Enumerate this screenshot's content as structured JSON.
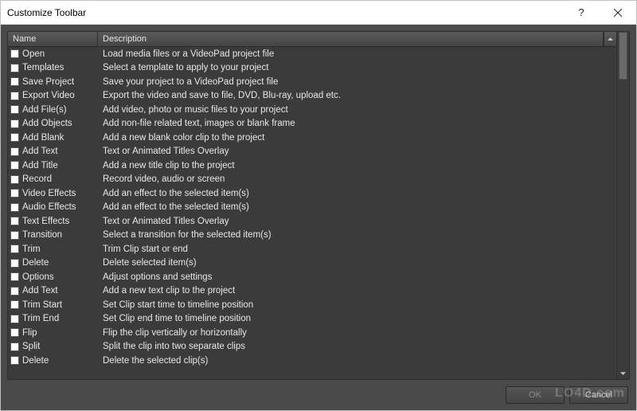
{
  "window": {
    "title": "Customize Toolbar"
  },
  "columns": {
    "name": "Name",
    "description": "Description"
  },
  "items": [
    {
      "name": "Open",
      "description": "Load media files or a VideoPad project file"
    },
    {
      "name": "Templates",
      "description": "Select a template to apply to your project"
    },
    {
      "name": "Save Project",
      "description": "Save your project to a VideoPad project file"
    },
    {
      "name": "Export Video",
      "description": "Export the video and save to file, DVD, Blu-ray, upload etc."
    },
    {
      "name": "Add File(s)",
      "description": "Add video, photo or music files to your project"
    },
    {
      "name": "Add Objects",
      "description": "Add non-file related text, images or blank frame"
    },
    {
      "name": "Add Blank",
      "description": "Add a new blank color clip to the project"
    },
    {
      "name": "Add Text",
      "description": "Text or Animated Titles Overlay"
    },
    {
      "name": "Add Title",
      "description": "Add a new title clip to the project"
    },
    {
      "name": "Record",
      "description": "Record video, audio or screen"
    },
    {
      "name": "Video Effects",
      "description": "Add an effect to the selected item(s)"
    },
    {
      "name": "Audio Effects",
      "description": "Add an effect to the selected item(s)"
    },
    {
      "name": "Text Effects",
      "description": "Text or Animated Titles Overlay"
    },
    {
      "name": "Transition",
      "description": "Select a transition for the selected item(s)"
    },
    {
      "name": "Trim",
      "description": "Trim Clip start or end"
    },
    {
      "name": "Delete",
      "description": "Delete selected item(s)"
    },
    {
      "name": "Options",
      "description": "Adjust options and settings"
    },
    {
      "name": "Add Text",
      "description": "Add a new text clip to the project"
    },
    {
      "name": "Trim Start",
      "description": "Set Clip start time to timeline position"
    },
    {
      "name": "Trim End",
      "description": "Set Clip end time to timeline position"
    },
    {
      "name": "Flip",
      "description": "Flip the clip vertically or horizontally"
    },
    {
      "name": "Split",
      "description": "Split the clip into two separate clips"
    },
    {
      "name": "Delete",
      "description": "Delete the selected clip(s)"
    }
  ],
  "buttons": {
    "ok": "OK",
    "cancel": "Cancel"
  },
  "watermark": "LO4D.com"
}
